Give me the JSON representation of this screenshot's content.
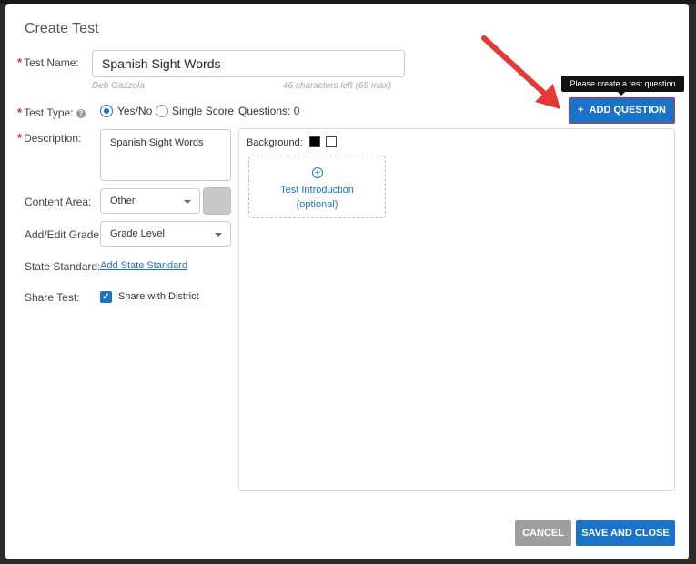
{
  "dialog": {
    "title": "Create Test"
  },
  "test_name": {
    "label": "Test Name:",
    "value": "Spanish Sight Words",
    "author": "Deb Gazzola",
    "chars_left": "46 characters left (65 max)"
  },
  "test_type": {
    "label": "Test Type:",
    "help_icon": "?",
    "option_yes_no": "Yes/No",
    "option_single_score": "Single Score",
    "selected": "Yes/No",
    "questions_count": "Questions: 0"
  },
  "description": {
    "label": "Description:",
    "value": "Spanish Sight Words"
  },
  "content_area": {
    "label": "Content Area:",
    "selected": "Other"
  },
  "grade": {
    "label": "Add/Edit Grade:",
    "selected": "Grade Level"
  },
  "state_standard": {
    "label": "State Standard:",
    "link": "Add State Standard"
  },
  "share": {
    "label": "Share Test:",
    "checkbox_label": "Share with District",
    "checked": true
  },
  "editor": {
    "background_label": "Background:",
    "background_swatches": [
      "#000000",
      "#ffffff"
    ],
    "intro_line1": "Test Introduction",
    "intro_line2": "(optional)",
    "intro_icon": "plus-circle-icon"
  },
  "add_question": {
    "label": "ADD QUESTION",
    "icon": "plus-icon",
    "tooltip": "Please create a test question"
  },
  "actions": {
    "cancel": "CANCEL",
    "save": "SAVE AND CLOSE"
  },
  "colors": {
    "primary": "#1a73c7",
    "required": "#d32f2f",
    "annotation_arrow": "#e53935"
  }
}
